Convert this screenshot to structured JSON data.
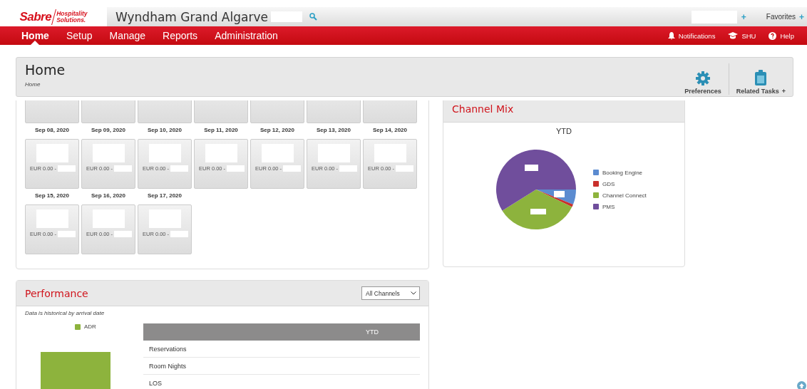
{
  "header": {
    "logo": {
      "brand": "Sabre",
      "tagline_1": "Hospitality",
      "tagline_2": "Solutions."
    },
    "property": "Wyndham Grand Algarve",
    "quick_add": "+",
    "favorites": {
      "label": "Favorites",
      "add": "+"
    }
  },
  "nav": {
    "items": [
      {
        "label": "Home",
        "selected": true
      },
      {
        "label": "Setup",
        "selected": false
      },
      {
        "label": "Manage",
        "selected": false
      },
      {
        "label": "Reports",
        "selected": false
      },
      {
        "label": "Administration",
        "selected": false
      }
    ],
    "utilities": [
      {
        "kind": "bell",
        "label": "Notifications"
      },
      {
        "kind": "cap",
        "label": "SHU"
      },
      {
        "kind": "help",
        "label": "Help"
      }
    ]
  },
  "page": {
    "title": "Home",
    "breadcrumb": "Home",
    "actions": [
      {
        "kind": "gear",
        "label": "Preferences"
      },
      {
        "kind": "clipboard",
        "label": "Related Tasks",
        "suffix": "+"
      }
    ]
  },
  "calendar": {
    "weeks": [
      {
        "days": [
          {
            "date": "Sep 08, 2020",
            "amount": "EUR 0.00 -"
          },
          {
            "date": "Sep 09, 2020",
            "amount": "EUR 0.00 -"
          },
          {
            "date": "Sep 10, 2020",
            "amount": "EUR 0.00 -"
          },
          {
            "date": "Sep 11, 2020",
            "amount": "EUR 0.00 -"
          },
          {
            "date": "Sep 12, 2020",
            "amount": "EUR 0.00 -"
          },
          {
            "date": "Sep 13, 2020",
            "amount": "EUR 0.00 -"
          },
          {
            "date": "Sep 14, 2020",
            "amount": "EUR 0.00 -"
          }
        ]
      },
      {
        "days": [
          {
            "date": "Sep 15, 2020",
            "amount": "EUR 0.00 -"
          },
          {
            "date": "Sep 16, 2020",
            "amount": "EUR 0.00 -"
          },
          {
            "date": "Sep 17, 2020",
            "amount": "EUR 0.00 -"
          }
        ]
      }
    ]
  },
  "channel_mix": {
    "title": "Channel Mix",
    "period": "YTD",
    "legend": [
      {
        "label": "Booking Engine",
        "color": "#5b8bd0"
      },
      {
        "label": "GDS",
        "color": "#c9302c"
      },
      {
        "label": "Channel Connect",
        "color": "#8db33d"
      },
      {
        "label": "PMS",
        "color": "#704e9c"
      }
    ]
  },
  "performance": {
    "title": "Performance",
    "filter": "All Channels",
    "note": "Data is historical by arrival date",
    "legend": [
      {
        "label": "ADR",
        "color": "#8db33d"
      }
    ],
    "table": {
      "column_header": "YTD",
      "rows": [
        "Reservations",
        "Room Nights",
        "LOS"
      ]
    }
  }
}
